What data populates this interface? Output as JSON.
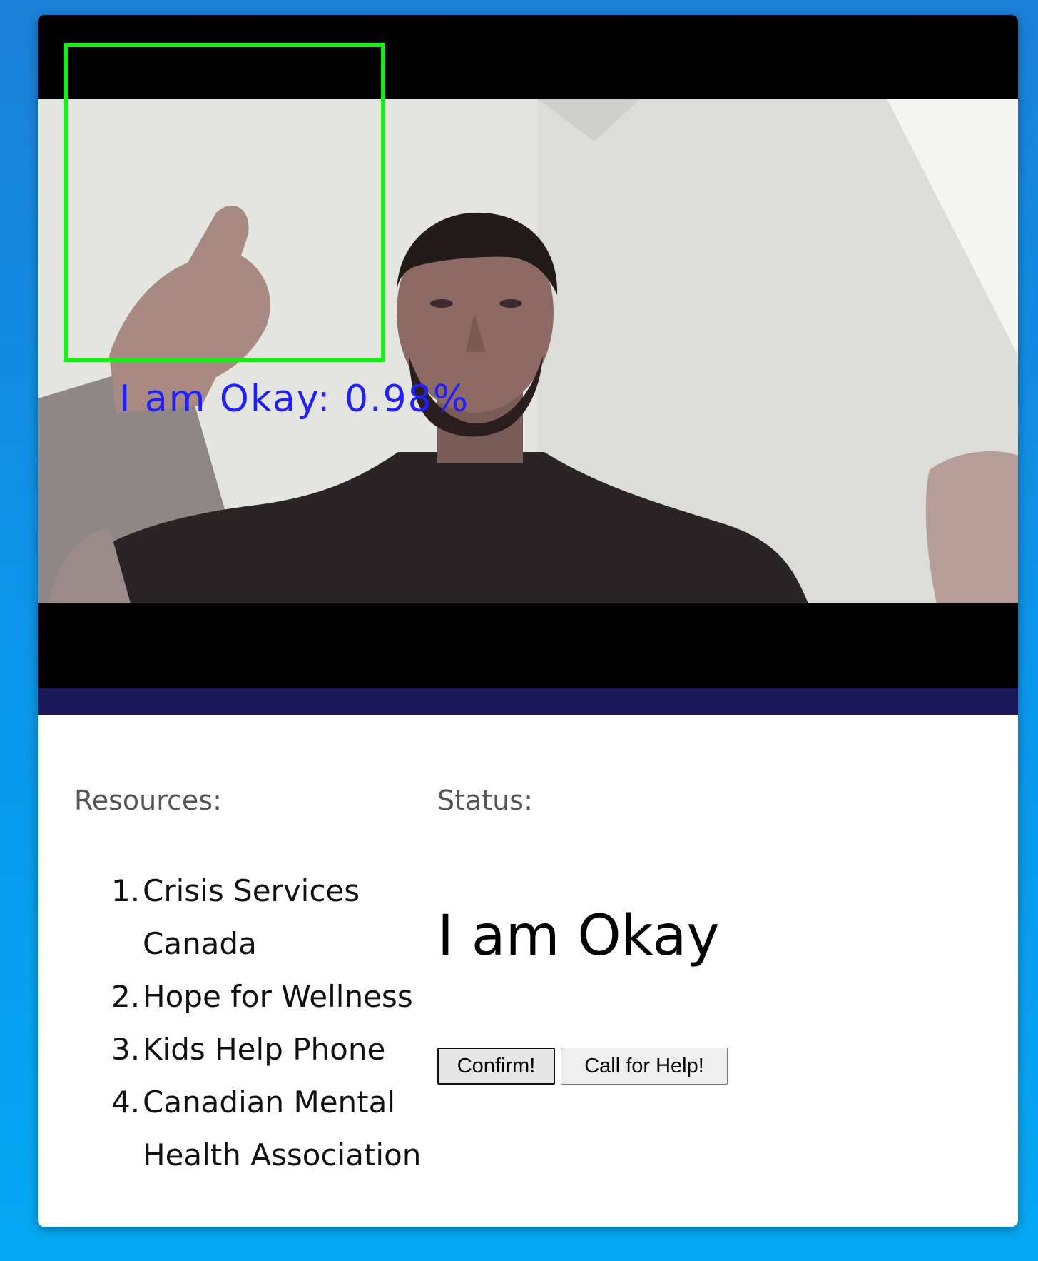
{
  "video": {
    "detection_label": "I am Okay: 0.98%"
  },
  "resources": {
    "heading": "Resources:",
    "items": [
      {
        "number": "1.",
        "label": "Crisis Services Canada"
      },
      {
        "number": "2.",
        "label": "Hope for Wellness"
      },
      {
        "number": "3.",
        "label": "Kids Help Phone"
      },
      {
        "number": "4.",
        "label": "Canadian Mental Health Association"
      }
    ]
  },
  "status": {
    "heading": "Status:",
    "value": "I am Okay"
  },
  "buttons": {
    "confirm_label": "Confirm!",
    "help_label": "Call for Help!"
  },
  "colors": {
    "detection_box": "#16ee16",
    "detection_text": "#1f1fff",
    "divider_bar": "#1a1858"
  }
}
